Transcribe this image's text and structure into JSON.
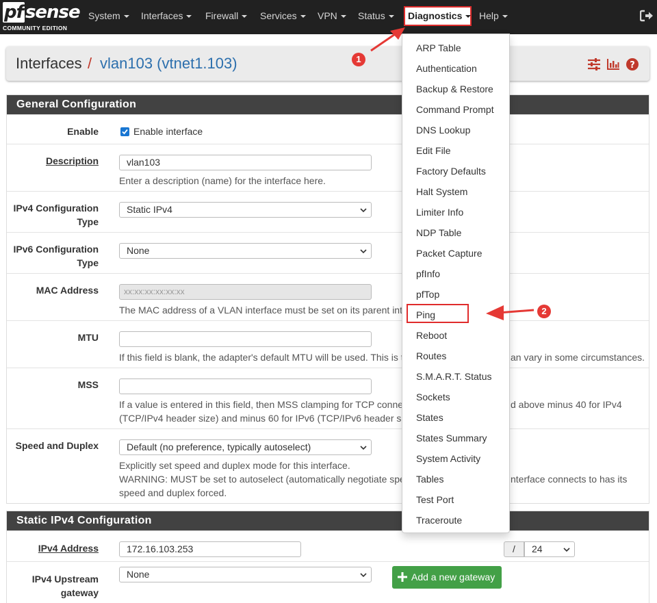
{
  "navbar": {
    "logo_text": "sense",
    "logo_pf": "pf",
    "logo_edition": "COMMUNITY EDITION",
    "menu": [
      "System",
      "Interfaces",
      "Firewall",
      "Services",
      "VPN",
      "Status",
      "Diagnostics",
      "Help"
    ]
  },
  "header": {
    "crumb1": "Interfaces",
    "separator": "/",
    "crumb2": "vlan103 (vtnet1.103)",
    "icons": [
      "sliders-icon",
      "chart-icon",
      "help-icon"
    ]
  },
  "general": {
    "title": "General Configuration",
    "enable_label": "Enable",
    "enable_checkbox_label": "Enable interface",
    "description_label": "Description",
    "description_value": "vlan103",
    "description_help": "Enter a description (name) for the interface here.",
    "ipv4_type_label_1": "IPv4 Configuration",
    "ipv4_type_label_2": "Type",
    "ipv4_type_value": "Static IPv4",
    "ipv6_type_label_1": "IPv6 Configuration",
    "ipv6_type_label_2": "Type",
    "ipv6_type_value": "None",
    "mac_label": "MAC Address",
    "mac_placeholder": "xx:xx:xx:xx:xx:xx",
    "mac_help_left": "The MAC address of a VLAN interface must be set on its parent int",
    "mtu_label": "MTU",
    "mtu_help_left": "If this field is blank, the adapter's default MTU will be used. This is t",
    "mtu_help_right": "an vary in some circumstances.",
    "mss_label": "MSS",
    "mss_help_left_1": "If a value is entered in this field, then MSS clamping for TCP conne",
    "mss_help_right_1": "d above minus 40 for IPv4",
    "mss_help_left_2": "(TCP/IPv4 header size) and minus 60 for IPv6 (TCP/IPv6 header siz",
    "speed_label": "Speed and Duplex",
    "speed_value": "Default (no preference, typically autoselect)",
    "speed_help_1": "Explicitly set speed and duplex mode for this interface.",
    "speed_help_2_left": "WARNING: MUST be set to autoselect (automatically negotiate spe",
    "speed_help_2_right": "nterface connects to has its",
    "speed_help_3": "speed and duplex forced."
  },
  "static_ipv4": {
    "title": "Static IPv4 Configuration",
    "address_label": "IPv4 Address",
    "address_value": "172.16.103.253",
    "cidr_sep": "/",
    "cidr_value": "24",
    "gateway_label_1": "IPv4 Upstream",
    "gateway_label_2": "gateway",
    "gateway_value": "None",
    "add_gateway_button": "Add a new gateway"
  },
  "diagnostics_menu": [
    "ARP Table",
    "Authentication",
    "Backup & Restore",
    "Command Prompt",
    "DNS Lookup",
    "Edit File",
    "Factory Defaults",
    "Halt System",
    "Limiter Info",
    "NDP Table",
    "Packet Capture",
    "pfInfo",
    "pfTop",
    "Ping",
    "Reboot",
    "Routes",
    "S.M.A.R.T. Status",
    "Sockets",
    "States",
    "States Summary",
    "System Activity",
    "Tables",
    "Test Port",
    "Traceroute"
  ],
  "annotations": {
    "badge1": "1",
    "badge2": "2"
  },
  "colors": {
    "navbar": "#212121",
    "accent_red": "#e02b2b",
    "link_blue": "#2c6fad",
    "green_button": "#43a047",
    "panel_head": "#424242"
  }
}
